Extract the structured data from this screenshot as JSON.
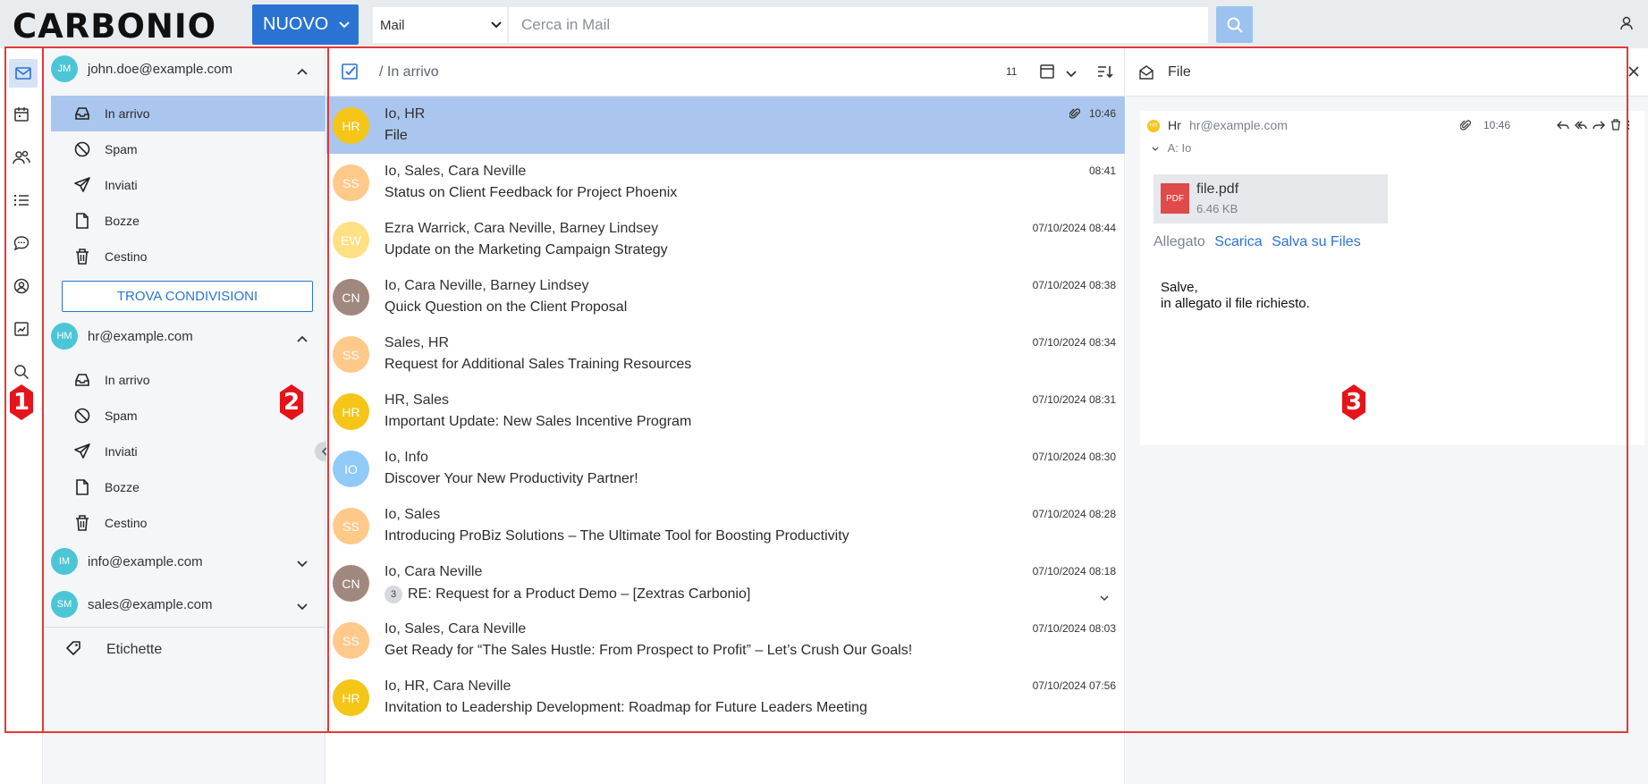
{
  "app": {
    "logo": "CARBONIO",
    "new_button": "NUOVO",
    "search_scope": "Mail",
    "search_placeholder": "Cerca in Mail"
  },
  "rail": {
    "items": [
      "mail-icon",
      "calendar-icon",
      "contacts-icon",
      "tasks-icon",
      "chat-icon",
      "support-icon",
      "files-icon",
      "search-icon"
    ]
  },
  "sidebar": {
    "accounts": [
      {
        "initials": "JM",
        "email": "john.doe@example.com",
        "color": "#4cc6d6",
        "folders": [
          {
            "label": "In arrivo",
            "icon": "inbox-icon"
          },
          {
            "label": "Spam",
            "icon": "spam-icon"
          },
          {
            "label": "Inviati",
            "icon": "sent-icon"
          },
          {
            "label": "Bozze",
            "icon": "drafts-icon"
          },
          {
            "label": "Cestino",
            "icon": "trash-icon"
          }
        ]
      },
      {
        "initials": "HM",
        "email": "hr@example.com",
        "color": "#4cc6d6",
        "folders": [
          {
            "label": "In arrivo",
            "icon": "inbox-icon"
          },
          {
            "label": "Spam",
            "icon": "spam-icon"
          },
          {
            "label": "Inviati",
            "icon": "sent-icon"
          },
          {
            "label": "Bozze",
            "icon": "drafts-icon"
          },
          {
            "label": "Cestino",
            "icon": "trash-icon"
          }
        ]
      },
      {
        "initials": "IM",
        "email": "info@example.com",
        "color": "#4cc6d6"
      },
      {
        "initials": "SM",
        "email": "sales@example.com",
        "color": "#4cc6d6"
      }
    ],
    "find_shares": "TROVA CONDIVISIONI",
    "labels": "Etichette"
  },
  "list": {
    "path": "/ In arrivo",
    "count": "11",
    "messages": [
      {
        "initials": "HR",
        "color": "#f5c518",
        "from": "Io, HR",
        "subject": "File",
        "date": "10:46",
        "attachment": true,
        "selected": true
      },
      {
        "initials": "SS",
        "color": "#ffc98a",
        "from": "Io, Sales, Cara Neville",
        "subject": "Status on Client Feedback for Project Phoenix",
        "date": "08:41"
      },
      {
        "initials": "EW",
        "color": "#ffe082",
        "from": "Ezra Warrick, Cara Neville, Barney Lindsey",
        "subject": "Update on the Marketing Campaign Strategy",
        "date": "07/10/2024 08:44"
      },
      {
        "initials": "CN",
        "color": "#a1887f",
        "from": "Io, Cara Neville, Barney Lindsey",
        "subject": "Quick Question on the Client Proposal",
        "date": "07/10/2024 08:38"
      },
      {
        "initials": "SS",
        "color": "#ffc98a",
        "from": "Sales, HR",
        "subject": "Request for Additional Sales Training Resources",
        "date": "07/10/2024 08:34"
      },
      {
        "initials": "HR",
        "color": "#f5c518",
        "from": "HR, Sales",
        "subject": "Important Update: New Sales Incentive Program",
        "date": "07/10/2024 08:31"
      },
      {
        "initials": "IO",
        "color": "#90caf9",
        "from": "Io, Info",
        "subject": "Discover Your New Productivity Partner!",
        "date": "07/10/2024 08:30"
      },
      {
        "initials": "SS",
        "color": "#ffc98a",
        "from": "Io, Sales",
        "subject": "Introducing ProBiz Solutions – The Ultimate Tool for Boosting Productivity",
        "date": "07/10/2024 08:28"
      },
      {
        "initials": "CN",
        "color": "#a1887f",
        "from": "Io, Cara Neville",
        "subject": "RE: Request for a Product Demo – [Zextras Carbonio]",
        "date": "07/10/2024 08:18",
        "thread_count": "3"
      },
      {
        "initials": "SS",
        "color": "#ffc98a",
        "from": "Io, Sales, Cara Neville",
        "subject": "Get Ready for “The Sales Hustle: From Prospect to Profit” – Let’s Crush Our Goals!",
        "date": "07/10/2024 08:03"
      },
      {
        "initials": "HR",
        "color": "#f5c518",
        "from": "Io, HR, Cara Neville",
        "subject": "Invitation to Leadership Development: Roadmap for Future Leaders Meeting",
        "date": "07/10/2024 07:56"
      }
    ]
  },
  "preview": {
    "title": "File",
    "sender_initials": "HR",
    "sender": "Hr",
    "sender_email": "hr@example.com",
    "time": "10:46",
    "to": "A: Io",
    "attachment_name": "file.pdf",
    "attachment_size": "6.46 KB",
    "attachment_type": "PDF",
    "attachment_label": "Allegato",
    "download": "Scarica",
    "save_files": "Salva su Files",
    "body": "Salve,\nin allegato il file richiesto."
  },
  "annotations": {
    "markers": [
      "1",
      "2",
      "3"
    ],
    "color": "#e53935"
  }
}
